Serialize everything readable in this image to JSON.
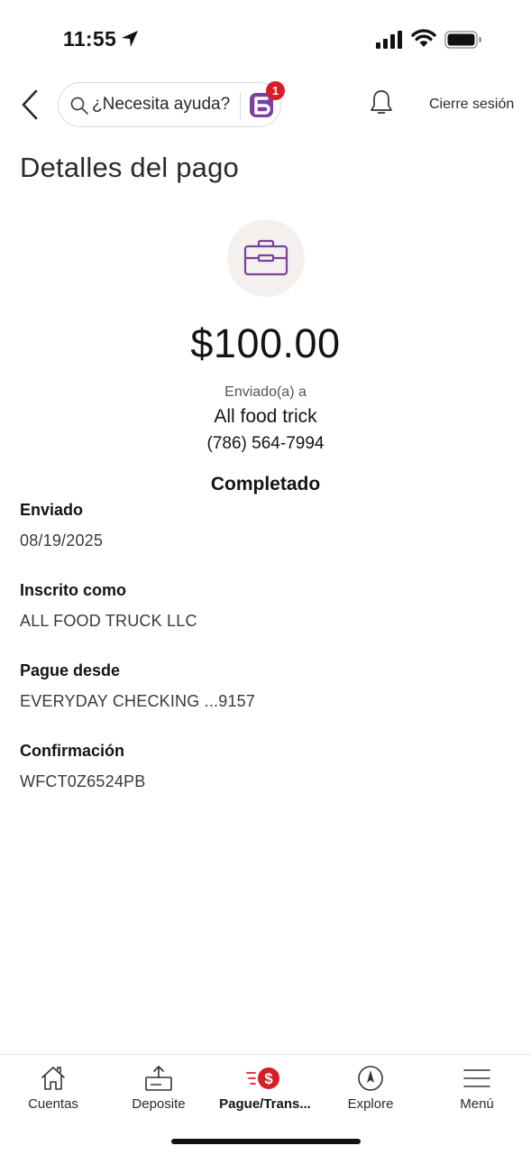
{
  "status_bar": {
    "time": "11:55"
  },
  "top_nav": {
    "search_placeholder": "¿Necesita ayuda?",
    "assistant_badge": "1",
    "logout_label": "Cierre sesión"
  },
  "page": {
    "title": "Detalles del pago"
  },
  "payment": {
    "amount": "$100.00",
    "sent_to_label": "Enviado(a) a",
    "recipient_name": "All food trick",
    "recipient_phone": "(786) 564-7994",
    "status": "Completado"
  },
  "details": [
    {
      "label": "Enviado",
      "value": "08/19/2025"
    },
    {
      "label": "Inscrito como",
      "value": "ALL FOOD TRUCK LLC"
    },
    {
      "label": "Pague desde",
      "value": "EVERYDAY CHECKING ...9157"
    },
    {
      "label": "Confirmación",
      "value": "WFCT0Z6524PB"
    }
  ],
  "bottom_nav": [
    {
      "label": "Cuentas",
      "icon": "home-icon"
    },
    {
      "label": "Deposite",
      "icon": "deposit-icon"
    },
    {
      "label": "Pague/Trans...",
      "icon": "pay-transfer-icon",
      "active": true
    },
    {
      "label": "Explore",
      "icon": "compass-icon"
    },
    {
      "label": "Menú",
      "icon": "menu-icon"
    }
  ],
  "colors": {
    "accent_red": "#d71e28",
    "brand_purple": "#7b3fa0",
    "icon_circle_bg": "#f4f0ed"
  }
}
